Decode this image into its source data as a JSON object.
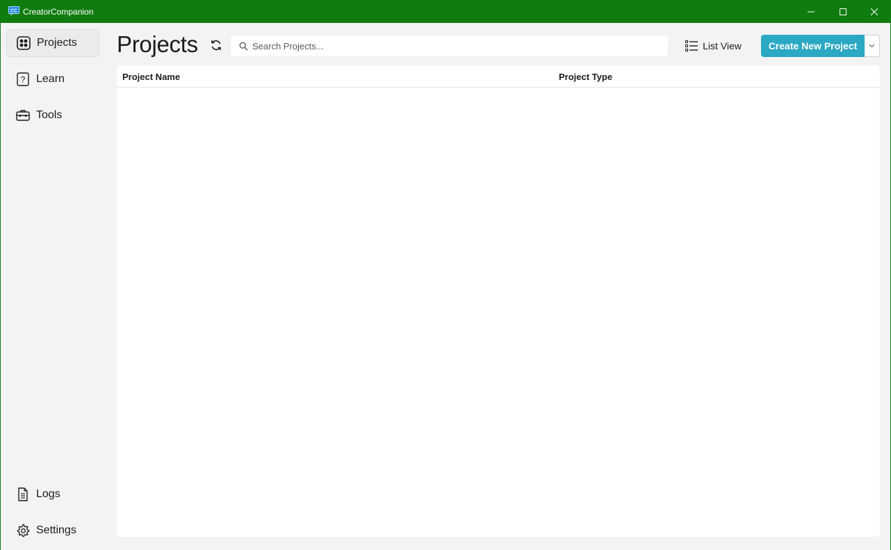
{
  "window": {
    "title": "CreatorCompanion",
    "titlebar_color": "#107c10"
  },
  "sidebar": {
    "items": [
      {
        "label": "Projects",
        "icon": "projects-grid-icon",
        "active": true
      },
      {
        "label": "Learn",
        "icon": "question-book-icon"
      },
      {
        "label": "Tools",
        "icon": "toolbox-icon"
      }
    ],
    "bottom_items": [
      {
        "label": "Logs",
        "icon": "document-list-icon"
      },
      {
        "label": "Settings",
        "icon": "gear-icon"
      }
    ]
  },
  "header": {
    "title": "Projects",
    "search": {
      "placeholder": "Search Projects...",
      "value": ""
    },
    "view_toggle_label": "List View",
    "create_button_label": "Create New Project",
    "accent_color": "#2aa8c4"
  },
  "table": {
    "columns": [
      "Project Name",
      "Project Type"
    ],
    "rows": []
  }
}
